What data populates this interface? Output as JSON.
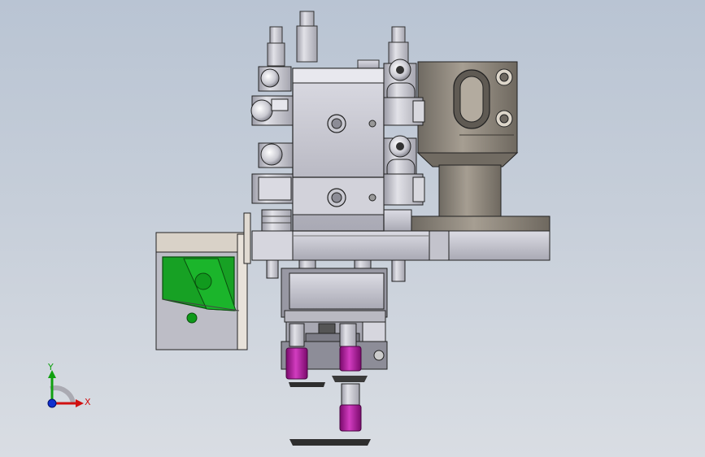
{
  "triad": {
    "x_label": "X",
    "y_label": "Y",
    "x_color": "#d01010",
    "y_color": "#10a010",
    "z_color": "#1030d0"
  },
  "colors": {
    "background_top": "#b9c4d3",
    "background_bottom": "#d9dde3",
    "steel": "#c8c8d0",
    "steel_dark": "#8e8e99",
    "bronze": "#8a8278",
    "green_plate": "#17a124",
    "magenta_cup": "#b2149f",
    "bracket": "#d9d2c8"
  }
}
